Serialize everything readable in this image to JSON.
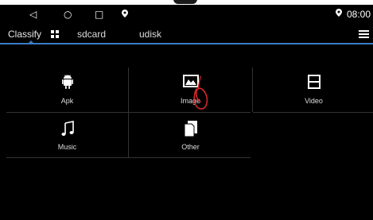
{
  "nav": {
    "back_icon": "◁",
    "home_icon": "○",
    "recent_icon": "□",
    "location_icon": "●"
  },
  "status": {
    "location_icon": "●",
    "time": "08:00"
  },
  "tabs": [
    {
      "label": "Classify"
    },
    {
      "label": "sdcard"
    },
    {
      "label": "udisk"
    }
  ],
  "categories": [
    {
      "label": "Apk",
      "icon": "android-icon"
    },
    {
      "label": "Image",
      "icon": "image-icon"
    },
    {
      "label": "Video",
      "icon": "video-icon"
    },
    {
      "label": "Music",
      "icon": "music-icon"
    },
    {
      "label": "Other",
      "icon": "other-icon"
    }
  ],
  "colors": {
    "background": "#000000",
    "tab_accent": "#3a7cc4",
    "grid_line": "#333333",
    "annotation": "#d4282a"
  }
}
